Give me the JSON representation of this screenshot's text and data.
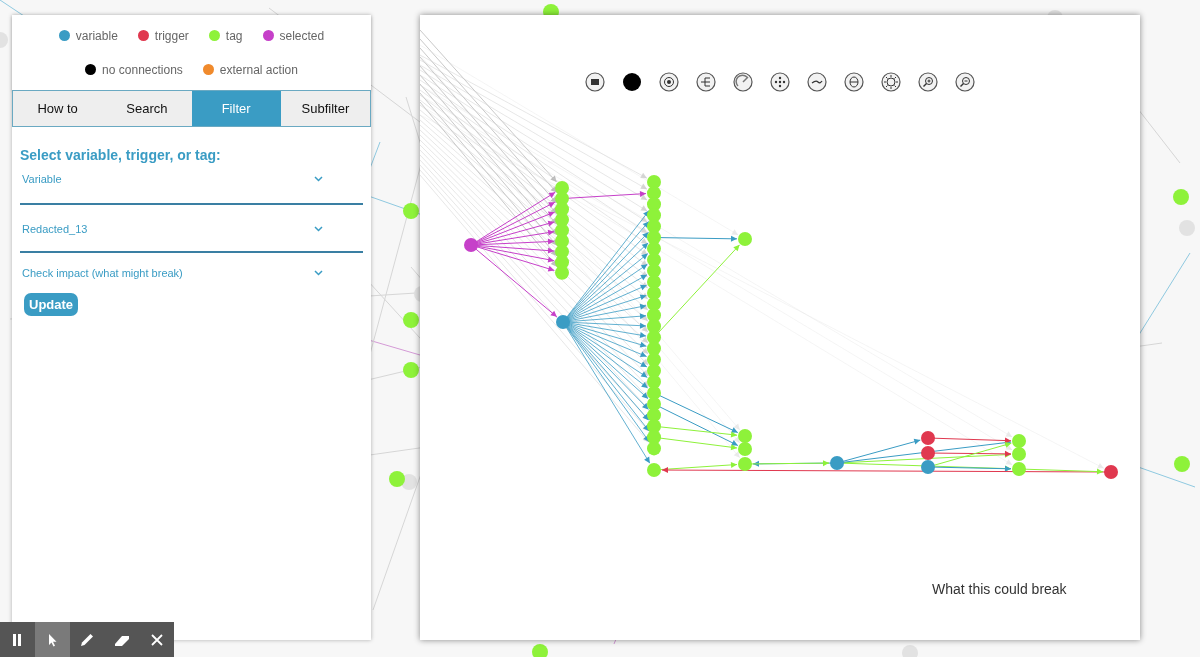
{
  "legend": [
    {
      "label": "variable",
      "color": "#3a9cc4"
    },
    {
      "label": "trigger",
      "color": "#e0384f"
    },
    {
      "label": "tag",
      "color": "#8ef23a"
    },
    {
      "label": "selected",
      "color": "#c640c9"
    },
    {
      "label": "no connections",
      "color": "#000000"
    },
    {
      "label": "external action",
      "color": "#f08a2c"
    }
  ],
  "tabs": [
    {
      "label": "How to",
      "selected": false
    },
    {
      "label": "Search",
      "selected": false
    },
    {
      "label": "Filter",
      "selected": true
    },
    {
      "label": "Subfilter",
      "selected": false
    }
  ],
  "filter": {
    "heading": "Select variable, trigger, or tag:",
    "dropdowns": [
      {
        "value": "Variable",
        "kind": "underlined"
      },
      {
        "value": "Redacted_13",
        "kind": "underlined"
      },
      {
        "value": "Check impact (what might break)",
        "kind": "plain"
      }
    ],
    "button": "Update"
  },
  "canvas": {
    "caption": "What this could break"
  },
  "tools": [
    {
      "kind": "pause",
      "selected": false
    },
    {
      "kind": "pointer",
      "selected": true
    },
    {
      "kind": "pencil",
      "selected": false
    },
    {
      "kind": "eraser",
      "selected": false
    },
    {
      "kind": "close",
      "selected": false
    }
  ]
}
